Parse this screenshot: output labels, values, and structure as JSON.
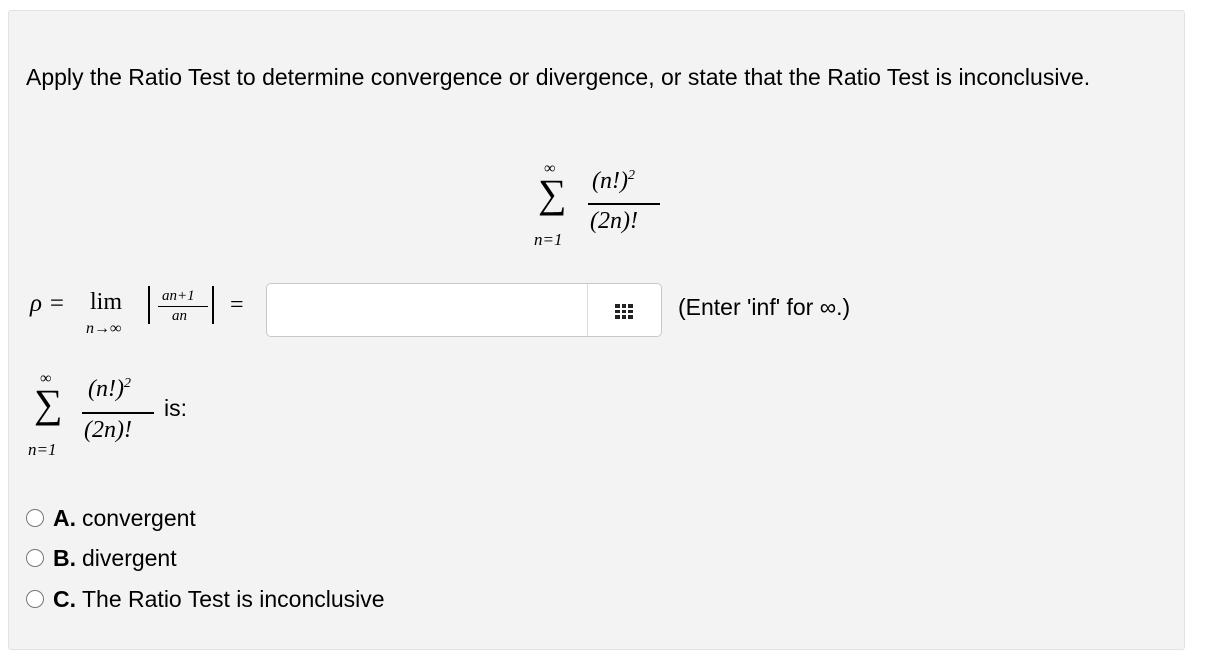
{
  "question": "Apply the Ratio Test to determine convergence or divergence, or state that the Ratio Test is inconclusive.",
  "series": {
    "sum_upper": "∞",
    "sum_lower": "n=1",
    "numerator": "(n!)",
    "numerator_exp": "2",
    "denominator": "(2n)!"
  },
  "rho_formula": {
    "rho": "ρ =",
    "lim": "lim",
    "lim_sub": "n→∞",
    "ratio_num": "an+1",
    "ratio_den": "an",
    "equals": "="
  },
  "answer": {
    "value": "",
    "placeholder": "",
    "keypad_icon": "grid-keypad-icon"
  },
  "hint": "(Enter 'inf' for ∞.)",
  "is_label": "is:",
  "options": [
    {
      "letter": "A.",
      "text": "convergent",
      "selected": false
    },
    {
      "letter": "B.",
      "text": "divergent",
      "selected": false
    },
    {
      "letter": "C.",
      "text": "The Ratio Test is inconclusive",
      "selected": false
    }
  ]
}
